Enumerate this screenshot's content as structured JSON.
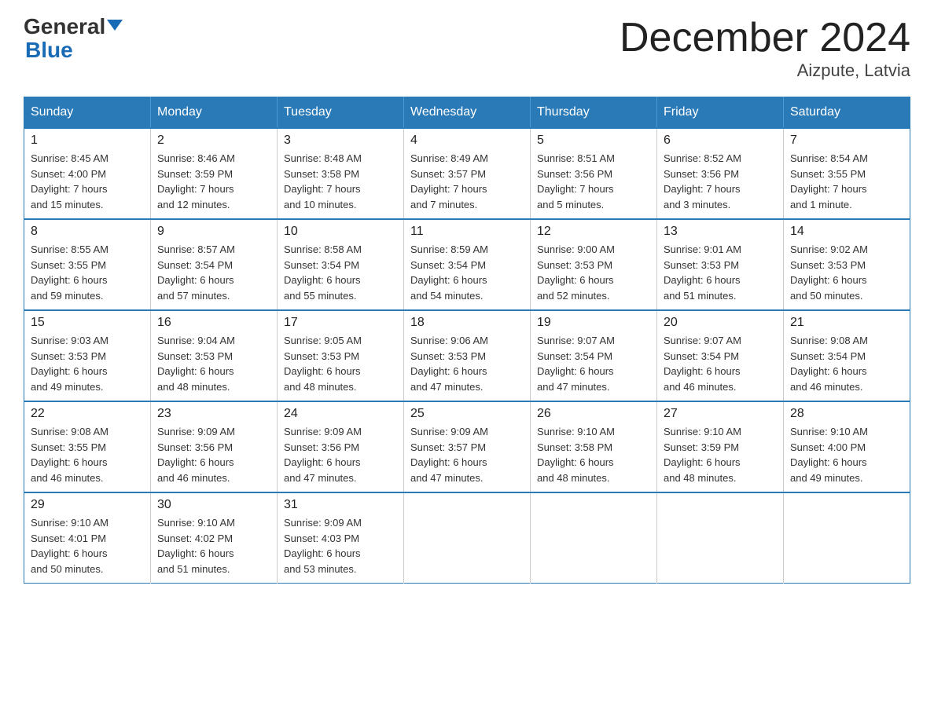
{
  "logo": {
    "line1a": "General",
    "line1b": "Blue",
    "line2": "Blue"
  },
  "title": "December 2024",
  "subtitle": "Aizpute, Latvia",
  "days_of_week": [
    "Sunday",
    "Monday",
    "Tuesday",
    "Wednesday",
    "Thursday",
    "Friday",
    "Saturday"
  ],
  "weeks": [
    [
      {
        "day": "1",
        "info": "Sunrise: 8:45 AM\nSunset: 4:00 PM\nDaylight: 7 hours\nand 15 minutes."
      },
      {
        "day": "2",
        "info": "Sunrise: 8:46 AM\nSunset: 3:59 PM\nDaylight: 7 hours\nand 12 minutes."
      },
      {
        "day": "3",
        "info": "Sunrise: 8:48 AM\nSunset: 3:58 PM\nDaylight: 7 hours\nand 10 minutes."
      },
      {
        "day": "4",
        "info": "Sunrise: 8:49 AM\nSunset: 3:57 PM\nDaylight: 7 hours\nand 7 minutes."
      },
      {
        "day": "5",
        "info": "Sunrise: 8:51 AM\nSunset: 3:56 PM\nDaylight: 7 hours\nand 5 minutes."
      },
      {
        "day": "6",
        "info": "Sunrise: 8:52 AM\nSunset: 3:56 PM\nDaylight: 7 hours\nand 3 minutes."
      },
      {
        "day": "7",
        "info": "Sunrise: 8:54 AM\nSunset: 3:55 PM\nDaylight: 7 hours\nand 1 minute."
      }
    ],
    [
      {
        "day": "8",
        "info": "Sunrise: 8:55 AM\nSunset: 3:55 PM\nDaylight: 6 hours\nand 59 minutes."
      },
      {
        "day": "9",
        "info": "Sunrise: 8:57 AM\nSunset: 3:54 PM\nDaylight: 6 hours\nand 57 minutes."
      },
      {
        "day": "10",
        "info": "Sunrise: 8:58 AM\nSunset: 3:54 PM\nDaylight: 6 hours\nand 55 minutes."
      },
      {
        "day": "11",
        "info": "Sunrise: 8:59 AM\nSunset: 3:54 PM\nDaylight: 6 hours\nand 54 minutes."
      },
      {
        "day": "12",
        "info": "Sunrise: 9:00 AM\nSunset: 3:53 PM\nDaylight: 6 hours\nand 52 minutes."
      },
      {
        "day": "13",
        "info": "Sunrise: 9:01 AM\nSunset: 3:53 PM\nDaylight: 6 hours\nand 51 minutes."
      },
      {
        "day": "14",
        "info": "Sunrise: 9:02 AM\nSunset: 3:53 PM\nDaylight: 6 hours\nand 50 minutes."
      }
    ],
    [
      {
        "day": "15",
        "info": "Sunrise: 9:03 AM\nSunset: 3:53 PM\nDaylight: 6 hours\nand 49 minutes."
      },
      {
        "day": "16",
        "info": "Sunrise: 9:04 AM\nSunset: 3:53 PM\nDaylight: 6 hours\nand 48 minutes."
      },
      {
        "day": "17",
        "info": "Sunrise: 9:05 AM\nSunset: 3:53 PM\nDaylight: 6 hours\nand 48 minutes."
      },
      {
        "day": "18",
        "info": "Sunrise: 9:06 AM\nSunset: 3:53 PM\nDaylight: 6 hours\nand 47 minutes."
      },
      {
        "day": "19",
        "info": "Sunrise: 9:07 AM\nSunset: 3:54 PM\nDaylight: 6 hours\nand 47 minutes."
      },
      {
        "day": "20",
        "info": "Sunrise: 9:07 AM\nSunset: 3:54 PM\nDaylight: 6 hours\nand 46 minutes."
      },
      {
        "day": "21",
        "info": "Sunrise: 9:08 AM\nSunset: 3:54 PM\nDaylight: 6 hours\nand 46 minutes."
      }
    ],
    [
      {
        "day": "22",
        "info": "Sunrise: 9:08 AM\nSunset: 3:55 PM\nDaylight: 6 hours\nand 46 minutes."
      },
      {
        "day": "23",
        "info": "Sunrise: 9:09 AM\nSunset: 3:56 PM\nDaylight: 6 hours\nand 46 minutes."
      },
      {
        "day": "24",
        "info": "Sunrise: 9:09 AM\nSunset: 3:56 PM\nDaylight: 6 hours\nand 47 minutes."
      },
      {
        "day": "25",
        "info": "Sunrise: 9:09 AM\nSunset: 3:57 PM\nDaylight: 6 hours\nand 47 minutes."
      },
      {
        "day": "26",
        "info": "Sunrise: 9:10 AM\nSunset: 3:58 PM\nDaylight: 6 hours\nand 48 minutes."
      },
      {
        "day": "27",
        "info": "Sunrise: 9:10 AM\nSunset: 3:59 PM\nDaylight: 6 hours\nand 48 minutes."
      },
      {
        "day": "28",
        "info": "Sunrise: 9:10 AM\nSunset: 4:00 PM\nDaylight: 6 hours\nand 49 minutes."
      }
    ],
    [
      {
        "day": "29",
        "info": "Sunrise: 9:10 AM\nSunset: 4:01 PM\nDaylight: 6 hours\nand 50 minutes."
      },
      {
        "day": "30",
        "info": "Sunrise: 9:10 AM\nSunset: 4:02 PM\nDaylight: 6 hours\nand 51 minutes."
      },
      {
        "day": "31",
        "info": "Sunrise: 9:09 AM\nSunset: 4:03 PM\nDaylight: 6 hours\nand 53 minutes."
      },
      {
        "day": "",
        "info": ""
      },
      {
        "day": "",
        "info": ""
      },
      {
        "day": "",
        "info": ""
      },
      {
        "day": "",
        "info": ""
      }
    ]
  ]
}
